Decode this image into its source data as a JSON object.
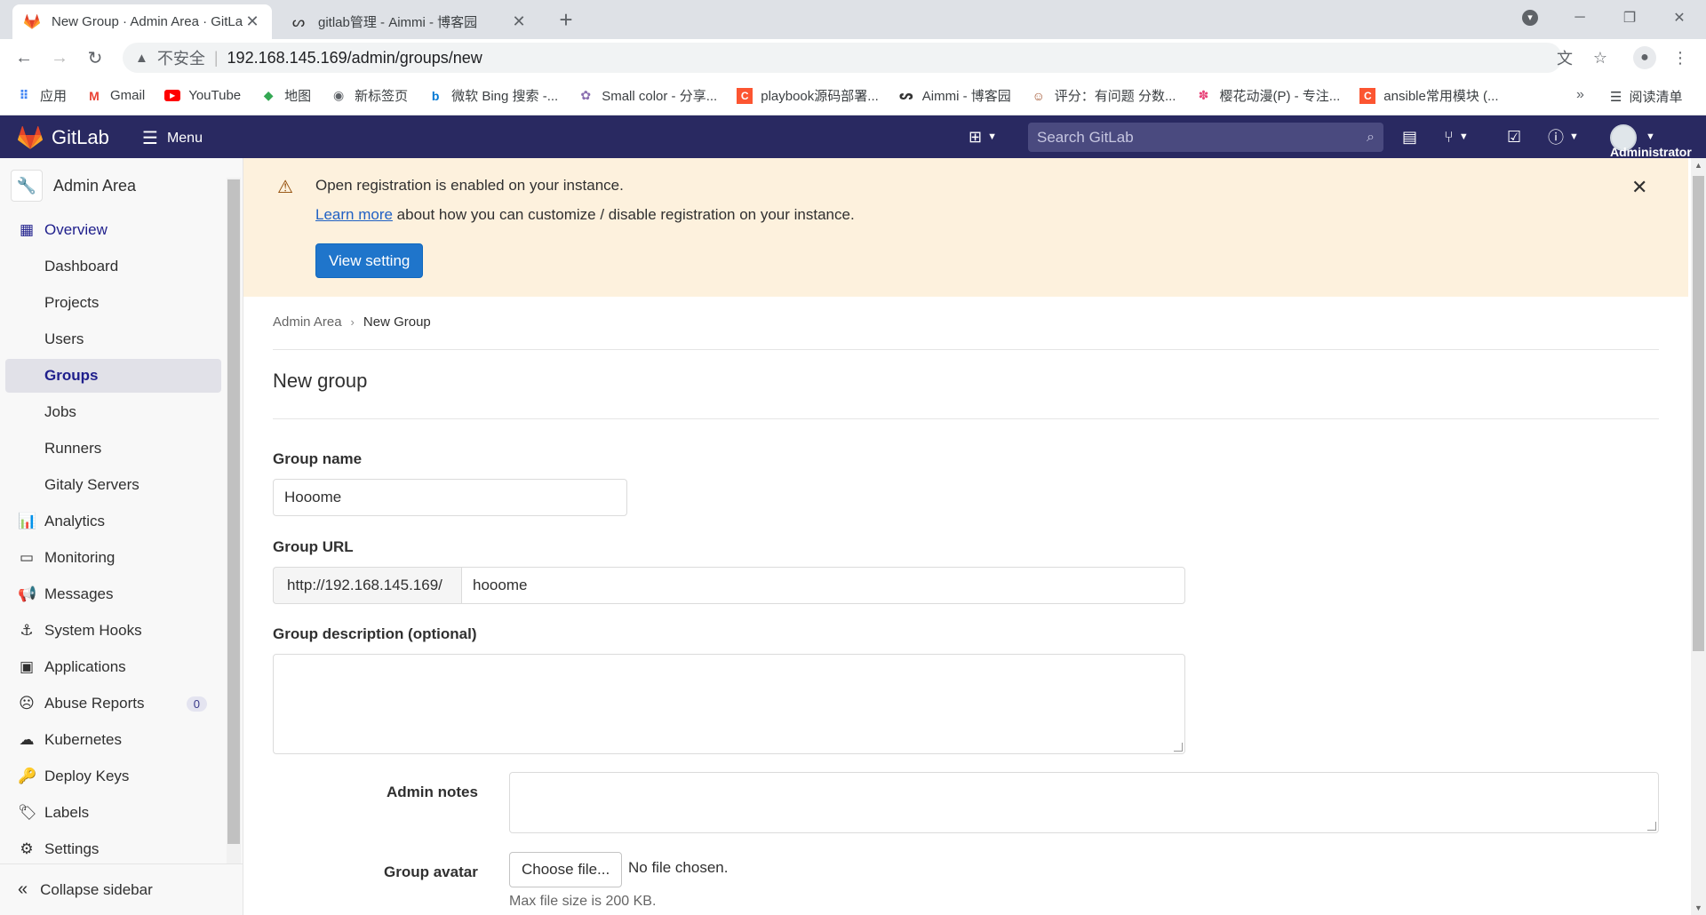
{
  "browser": {
    "tabs": [
      {
        "title": "New Group · Admin Area · GitLab",
        "active": true
      },
      {
        "title": "gitlab管理 - Aimmi - 博客园",
        "active": false
      }
    ],
    "address": {
      "insecure_label": "不安全",
      "url": "192.168.145.169/admin/groups/new"
    },
    "bookmarks": [
      {
        "label": "应用",
        "icon": "apps-grid-icon"
      },
      {
        "label": "Gmail",
        "icon": "gmail-icon"
      },
      {
        "label": "YouTube",
        "icon": "youtube-icon"
      },
      {
        "label": "地图",
        "icon": "maps-icon"
      },
      {
        "label": "新标签页",
        "icon": "globe-icon"
      },
      {
        "label": "微软 Bing 搜索 -...",
        "icon": "bing-icon"
      },
      {
        "label": "Small color - 分享...",
        "icon": "site-icon"
      },
      {
        "label": "playbook源码部署...",
        "icon": "csdn-icon"
      },
      {
        "label": "Aimmi - 博客园",
        "icon": "cnblogs-icon"
      },
      {
        "label": "评分：有问题 分数...",
        "icon": "site-icon"
      },
      {
        "label": "樱花动漫(P) - 专注...",
        "icon": "flower-icon"
      },
      {
        "label": "ansible常用模块 (...",
        "icon": "csdn-icon"
      }
    ],
    "bookmarks_more": "»",
    "reading_list": "阅读清单"
  },
  "gitlab": {
    "brand": "GitLab",
    "menu_label": "Menu",
    "search_placeholder": "Search GitLab",
    "user_label": "Administrator",
    "colors": {
      "header": "#292961",
      "accent": "#1f75cb",
      "banner": "#fdf1dd"
    }
  },
  "sidebar": {
    "context_title": "Admin Area",
    "overview": "Overview",
    "overview_items": [
      "Dashboard",
      "Projects",
      "Users",
      "Groups",
      "Jobs",
      "Runners",
      "Gitaly Servers"
    ],
    "active_item": "Groups",
    "sections": [
      {
        "label": "Analytics",
        "icon": "chart-icon"
      },
      {
        "label": "Monitoring",
        "icon": "monitor-icon"
      },
      {
        "label": "Messages",
        "icon": "megaphone-icon"
      },
      {
        "label": "System Hooks",
        "icon": "hook-icon"
      },
      {
        "label": "Applications",
        "icon": "applications-icon"
      },
      {
        "label": "Abuse Reports",
        "icon": "abuse-icon",
        "badge": "0"
      },
      {
        "label": "Kubernetes",
        "icon": "kubernetes-icon"
      },
      {
        "label": "Deploy Keys",
        "icon": "key-icon"
      },
      {
        "label": "Labels",
        "icon": "label-icon"
      },
      {
        "label": "Settings",
        "icon": "gear-icon"
      }
    ],
    "collapse_label": "Collapse sidebar"
  },
  "banner": {
    "title": "Open registration is enabled on your instance.",
    "link_text": "Learn more",
    "text_rest": " about how you can customize / disable registration on your instance.",
    "button_label": "View setting"
  },
  "breadcrumb": {
    "parent": "Admin Area",
    "current": "New Group"
  },
  "form": {
    "page_title": "New group",
    "group_name_label": "Group name",
    "group_name_value": "Hooome",
    "group_url_label": "Group URL",
    "group_url_prefix": "http://192.168.145.169/",
    "group_url_value": "hooome",
    "description_label": "Group description (optional)",
    "admin_notes_label": "Admin notes",
    "avatar_label": "Group avatar",
    "choose_file_label": "Choose file...",
    "no_file_label": "No file chosen.",
    "max_size_hint": "Max file size is 200 KB."
  }
}
